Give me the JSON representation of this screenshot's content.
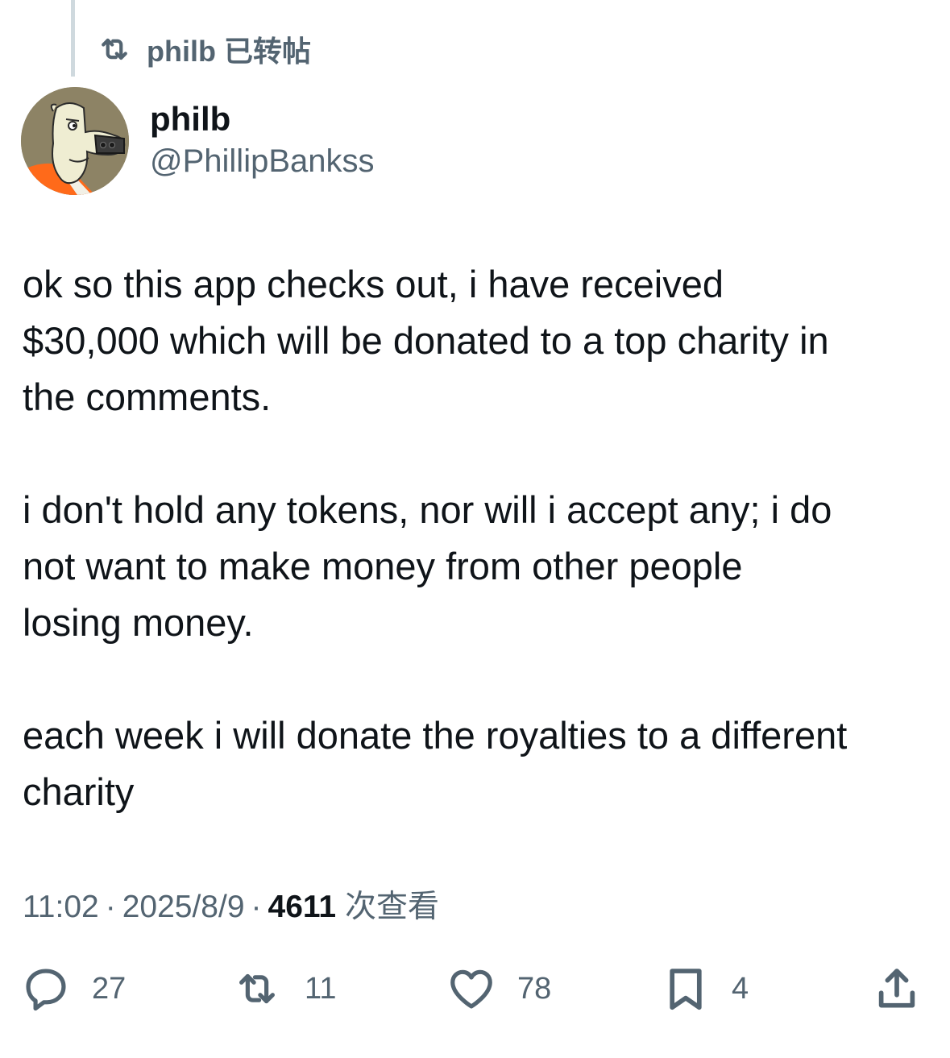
{
  "repost": {
    "label": "philb 已转帖"
  },
  "author": {
    "name": "philb",
    "handle": "@PhillipBankss"
  },
  "tweet": {
    "paragraphs": [
      "ok so this app checks out, i have received\n$30,000 which will be donated to a top charity in\nthe comments.",
      "i don't hold any tokens, nor will i accept any; i do\nnot want to make money from other people\nlosing money.",
      "each week i will donate the royalties to a different\ncharity"
    ]
  },
  "meta": {
    "time": "11:02",
    "separator": "·",
    "date": "2025/8/9",
    "views_count": "4611",
    "views_label": "次查看"
  },
  "actions": {
    "replies": "27",
    "reposts": "11",
    "likes": "78",
    "bookmarks": "4"
  },
  "icons": {
    "repost_indicator": "repost-icon",
    "reply": "reply-icon",
    "repost": "repost-icon",
    "like": "heart-icon",
    "bookmark": "bookmark-icon",
    "share": "share-icon"
  },
  "colors": {
    "text_primary": "#0f1419",
    "text_secondary": "#536471",
    "thread_line": "#cfd9de"
  }
}
